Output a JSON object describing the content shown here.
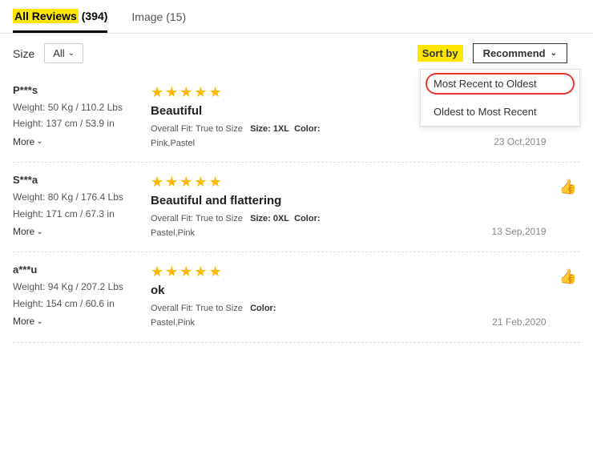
{
  "tabs": [
    {
      "id": "all-reviews",
      "label": "All Reviews",
      "highlight": true,
      "count": "(394)",
      "active": true
    },
    {
      "id": "image-reviews",
      "label": "Image",
      "count": "(15)",
      "active": false
    }
  ],
  "filters": {
    "size_label": "Size",
    "size_value": "All",
    "sort_label": "Sort by",
    "sort_button_label": "Recommend",
    "sort_options": [
      {
        "id": "most-recent",
        "label": "Most Recent to Oldest"
      },
      {
        "id": "oldest",
        "label": "Oldest to Most Recent"
      }
    ]
  },
  "reviews": [
    {
      "id": "review-1",
      "reviewer": "P***s",
      "weight": "Weight: 50 Kg / 110.2 Lbs",
      "height": "Height: 137 cm / 53.9 in",
      "more_label": "More",
      "stars": 5,
      "title": "Beautiful",
      "fit": "Overall Fit: True to Size",
      "size": "Size: 1XL",
      "color_label": "Color:",
      "color_value": "Pink,Pastel",
      "date": "23 Oct,2019"
    },
    {
      "id": "review-2",
      "reviewer": "S***a",
      "weight": "Weight: 80 Kg / 176.4 Lbs",
      "height": "Height: 171 cm / 67.3 in",
      "more_label": "More",
      "stars": 5,
      "title": "Beautiful and flattering",
      "fit": "Overall Fit: True to Size",
      "size": "Size: 0XL",
      "color_label": "Color:",
      "color_value": "Pastel,Pink",
      "date": "13 Sep,2019"
    },
    {
      "id": "review-3",
      "reviewer": "a***u",
      "weight": "Weight: 94 Kg / 207.2 Lbs",
      "height": "Height: 154 cm / 60.6 in",
      "more_label": "More",
      "stars": 5,
      "title": "ok",
      "fit": "Overall Fit: True to Size",
      "size": "",
      "color_label": "Color:",
      "color_value": "Pastel,Pink",
      "date": "21 Feb,2020"
    }
  ]
}
